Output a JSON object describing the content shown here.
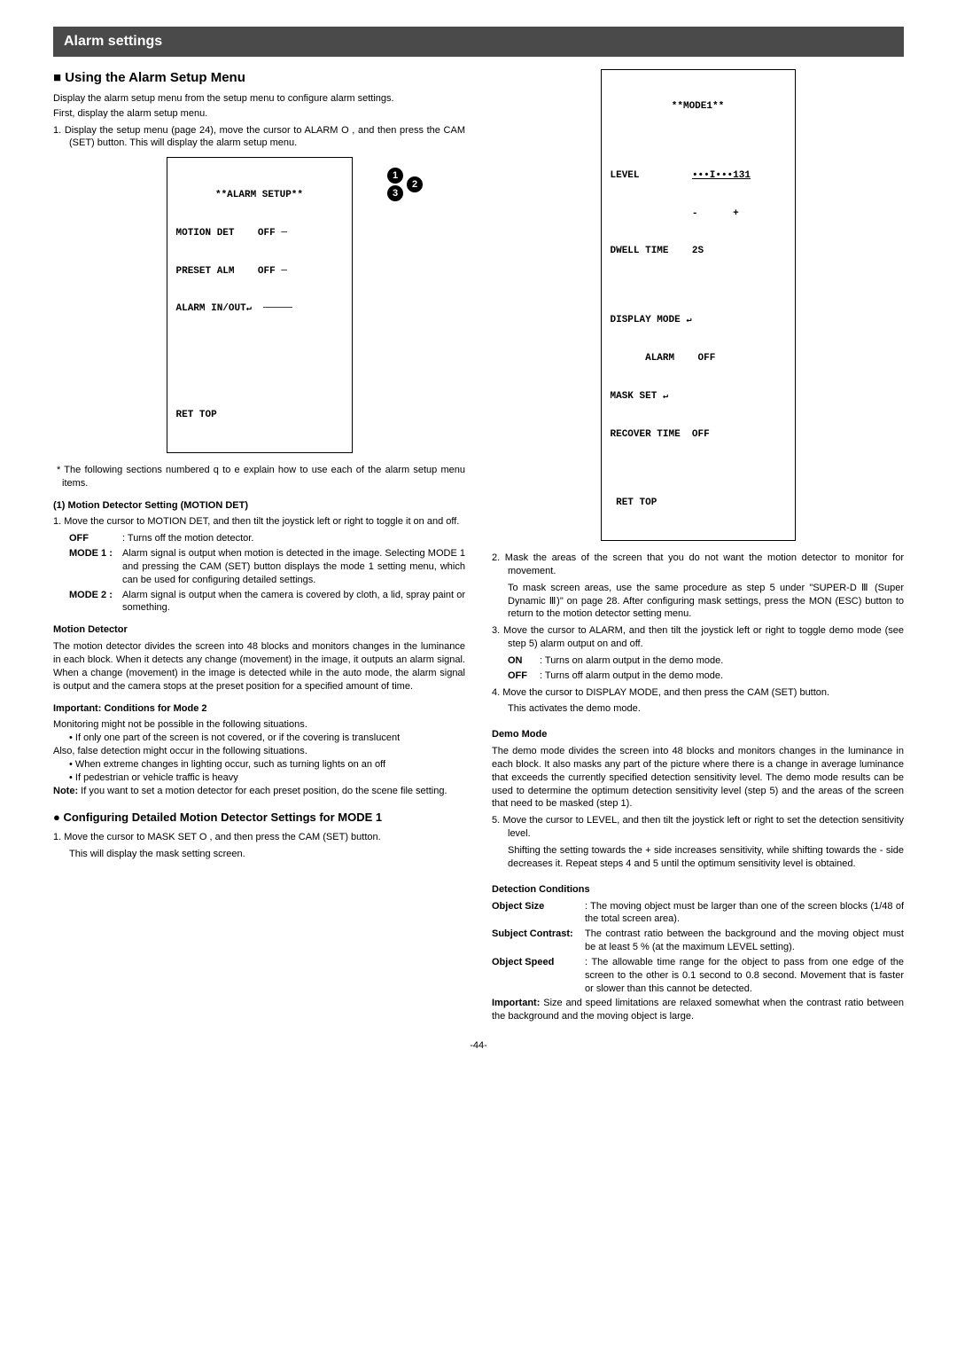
{
  "header": "Alarm settings",
  "mainHeading": "■ Using the Alarm Setup Menu",
  "intro1": "Display the alarm setup menu from the setup menu to configure alarm settings.",
  "intro2": "First, display the alarm setup menu.",
  "step1": "1. Display the setup menu (page 24), move the cursor to ALARM O , and then press the CAM (SET) button. This will display the alarm setup menu.",
  "alarmMenu": {
    "title": "**ALARM SETUP**",
    "l1a": "MOTION DET",
    "l1b": "OFF",
    "l2a": "PRESET ALM",
    "l2b": "OFF",
    "l3": "ALARM IN/OUT",
    "ret": "RET TOP"
  },
  "footnote": "* The following sections numbered q to e explain how to use each of the alarm setup menu items.",
  "s1h": "(1)  Motion Detector Setting (MOTION DET)",
  "s1step1": "1. Move the cursor to MOTION DET, and then tilt the joystick left or right to toggle it on and off.",
  "offLbl": "OFF",
  "offTxt": ": Turns off the motion detector.",
  "m1Lbl": "MODE 1 :",
  "m1Txt": "Alarm signal is output when motion is detected in the image. Selecting MODE 1 and pressing the CAM (SET) button displays the mode 1 setting menu, which can be used for configuring detailed settings.",
  "m2Lbl": "MODE 2 :",
  "m2Txt": "Alarm signal is output when the camera is covered by cloth, a lid, spray paint or something.",
  "mdH": "Motion Detector",
  "mdTxt": "The motion detector divides the screen into 48 blocks and monitors changes in the luminance in each block. When it detects any change (movement) in the image, it outputs an alarm signal. When a change (movement) in the image is detected while in the auto mode, the alarm signal is output and the camera stops at the preset position for a specified amount of time.",
  "impH": "Important: Conditions for Mode 2",
  "impTxt": "Monitoring might not be possible in the following situations.",
  "impB1": "• If only one part of the screen is not covered, or if the covering is translucent",
  "alsoTxt": "Also, false detection might occur in the following situations.",
  "impB2": "• When extreme changes in lighting occur, such as turning lights on an off",
  "impB3": "• If pedestrian or vehicle traffic is heavy",
  "noteTxt": "Note: If you want to set a motion detector for each preset position, do the scene file setting.",
  "cfgH": "● Configuring Detailed Motion Detector Settings for MODE 1",
  "cfgS1": "1. Move the cursor to MASK SET O , and then press the CAM (SET) button.",
  "cfgS1b": "This will display the mask setting screen.",
  "mode1Menu": {
    "title": "**MODE1**",
    "l1a": "LEVEL",
    "l1b": "•••I•••131",
    "l2a": "DWELL TIME",
    "l2b": "2S",
    "l3": "DISPLAY MODE",
    "l3ba": "ALARM",
    "l3bb": "OFF",
    "l4": "MASK SET",
    "l5a": "RECOVER TIME",
    "l5b": "OFF",
    "ret": "RET TOP"
  },
  "r2": "2. Mask the areas of the screen that you do not want the motion detector to monitor for movement.",
  "r2b": "To mask screen areas, use the same procedure as step 5 under \"SUPER-D Ⅲ (Super Dynamic Ⅲ)\" on page 28. After configuring mask settings, press the MON (ESC) button to return to the motion detector setting menu.",
  "r3": "3. Move the cursor to ALARM, and then tilt the joystick left or right to toggle demo mode (see step 5) alarm output on and off.",
  "r3onLbl": "ON",
  "r3onTxt": ": Turns on alarm output in the demo mode.",
  "r3offLbl": "OFF",
  "r3offTxt": ": Turns off alarm output in the demo mode.",
  "r4": "4. Move the cursor to DISPLAY MODE, and then press the CAM (SET) button.",
  "r4b": "This activates the demo mode.",
  "demoH": "Demo Mode",
  "demoTxt": "The demo mode divides the screen into 48 blocks and monitors changes in the luminance in each block. It also masks any part of the picture where there is a change in average luminance that exceeds the currently specified detection sensitivity level. The demo mode results can be used to determine the optimum detection sensitivity level (step 5) and the areas of the screen that need to be masked (step 1).",
  "r5": "5. Move the cursor to LEVEL, and then tilt the joystick left or right to set the detection sensitivity level.",
  "r5b": "Shifting the setting towards the + side increases sensitivity, while shifting towards the - side decreases it. Repeat steps 4 and 5 until the optimum sensitivity level is obtained.",
  "dcH": "Detection Conditions",
  "dc1Lbl": "Object Size",
  "dc1Txt": ": The moving object must be larger than one of the screen blocks (1/48 of the total screen area).",
  "dc2Lbl": "Subject Contrast:",
  "dc2Txt": "The contrast ratio between the background and the moving object must be at least 5 % (at the maximum LEVEL setting).",
  "dc3Lbl": "Object Speed",
  "dc3Txt": ": The allowable time range for the object to pass from one edge of the screen to the other is 0.1 second to 0.8 second. Movement that is faster or slower than this cannot be detected.",
  "impFinal": "Important: Size and speed limitations are relaxed somewhat when the contrast ratio between the background and the moving object is large.",
  "page": "-44-"
}
